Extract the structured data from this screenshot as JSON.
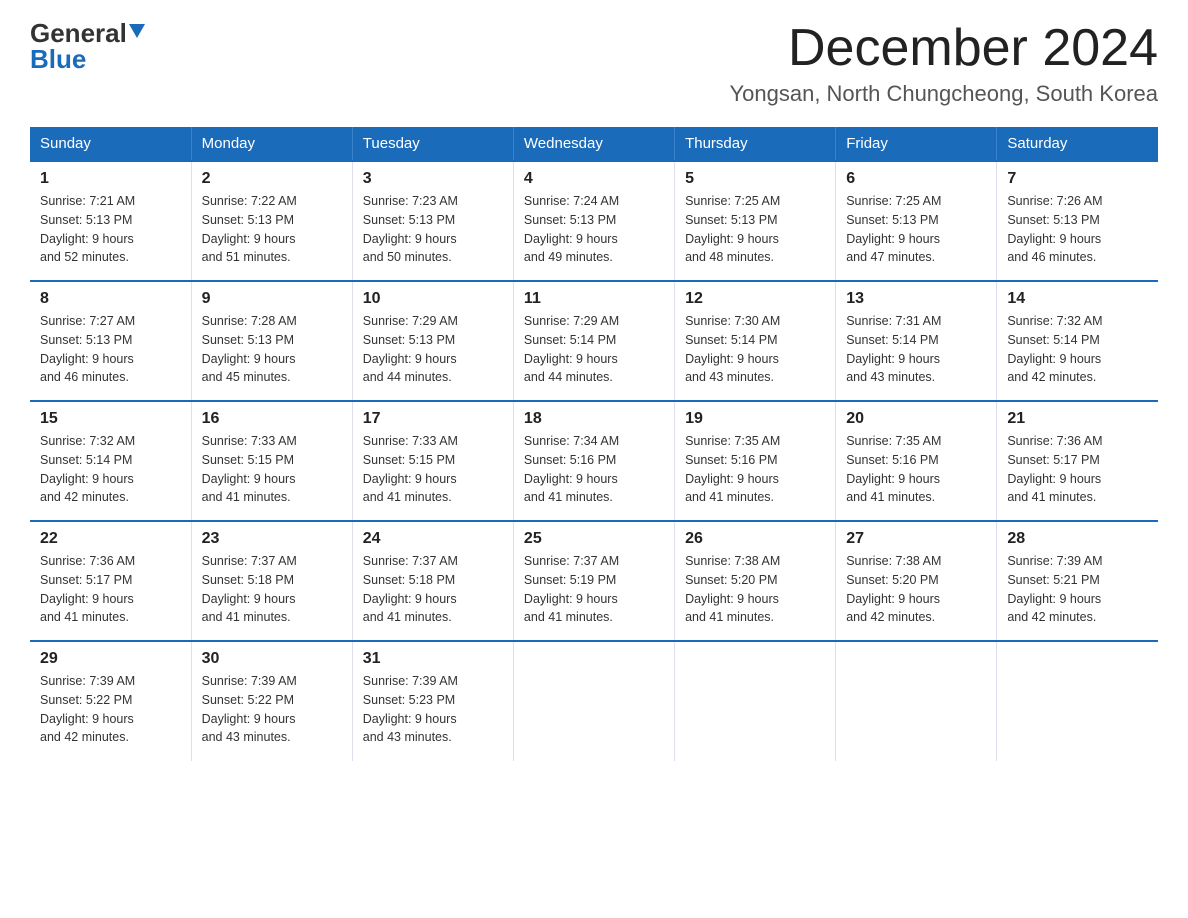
{
  "header": {
    "logo_general": "General",
    "logo_blue": "Blue",
    "month_title": "December 2024",
    "location": "Yongsan, North Chungcheong, South Korea"
  },
  "weekdays": [
    "Sunday",
    "Monday",
    "Tuesday",
    "Wednesday",
    "Thursday",
    "Friday",
    "Saturday"
  ],
  "weeks": [
    [
      {
        "day": "1",
        "sunrise": "7:21 AM",
        "sunset": "5:13 PM",
        "daylight": "9 hours and 52 minutes."
      },
      {
        "day": "2",
        "sunrise": "7:22 AM",
        "sunset": "5:13 PM",
        "daylight": "9 hours and 51 minutes."
      },
      {
        "day": "3",
        "sunrise": "7:23 AM",
        "sunset": "5:13 PM",
        "daylight": "9 hours and 50 minutes."
      },
      {
        "day": "4",
        "sunrise": "7:24 AM",
        "sunset": "5:13 PM",
        "daylight": "9 hours and 49 minutes."
      },
      {
        "day": "5",
        "sunrise": "7:25 AM",
        "sunset": "5:13 PM",
        "daylight": "9 hours and 48 minutes."
      },
      {
        "day": "6",
        "sunrise": "7:25 AM",
        "sunset": "5:13 PM",
        "daylight": "9 hours and 47 minutes."
      },
      {
        "day": "7",
        "sunrise": "7:26 AM",
        "sunset": "5:13 PM",
        "daylight": "9 hours and 46 minutes."
      }
    ],
    [
      {
        "day": "8",
        "sunrise": "7:27 AM",
        "sunset": "5:13 PM",
        "daylight": "9 hours and 46 minutes."
      },
      {
        "day": "9",
        "sunrise": "7:28 AM",
        "sunset": "5:13 PM",
        "daylight": "9 hours and 45 minutes."
      },
      {
        "day": "10",
        "sunrise": "7:29 AM",
        "sunset": "5:13 PM",
        "daylight": "9 hours and 44 minutes."
      },
      {
        "day": "11",
        "sunrise": "7:29 AM",
        "sunset": "5:14 PM",
        "daylight": "9 hours and 44 minutes."
      },
      {
        "day": "12",
        "sunrise": "7:30 AM",
        "sunset": "5:14 PM",
        "daylight": "9 hours and 43 minutes."
      },
      {
        "day": "13",
        "sunrise": "7:31 AM",
        "sunset": "5:14 PM",
        "daylight": "9 hours and 43 minutes."
      },
      {
        "day": "14",
        "sunrise": "7:32 AM",
        "sunset": "5:14 PM",
        "daylight": "9 hours and 42 minutes."
      }
    ],
    [
      {
        "day": "15",
        "sunrise": "7:32 AM",
        "sunset": "5:14 PM",
        "daylight": "9 hours and 42 minutes."
      },
      {
        "day": "16",
        "sunrise": "7:33 AM",
        "sunset": "5:15 PM",
        "daylight": "9 hours and 41 minutes."
      },
      {
        "day": "17",
        "sunrise": "7:33 AM",
        "sunset": "5:15 PM",
        "daylight": "9 hours and 41 minutes."
      },
      {
        "day": "18",
        "sunrise": "7:34 AM",
        "sunset": "5:16 PM",
        "daylight": "9 hours and 41 minutes."
      },
      {
        "day": "19",
        "sunrise": "7:35 AM",
        "sunset": "5:16 PM",
        "daylight": "9 hours and 41 minutes."
      },
      {
        "day": "20",
        "sunrise": "7:35 AM",
        "sunset": "5:16 PM",
        "daylight": "9 hours and 41 minutes."
      },
      {
        "day": "21",
        "sunrise": "7:36 AM",
        "sunset": "5:17 PM",
        "daylight": "9 hours and 41 minutes."
      }
    ],
    [
      {
        "day": "22",
        "sunrise": "7:36 AM",
        "sunset": "5:17 PM",
        "daylight": "9 hours and 41 minutes."
      },
      {
        "day": "23",
        "sunrise": "7:37 AM",
        "sunset": "5:18 PM",
        "daylight": "9 hours and 41 minutes."
      },
      {
        "day": "24",
        "sunrise": "7:37 AM",
        "sunset": "5:18 PM",
        "daylight": "9 hours and 41 minutes."
      },
      {
        "day": "25",
        "sunrise": "7:37 AM",
        "sunset": "5:19 PM",
        "daylight": "9 hours and 41 minutes."
      },
      {
        "day": "26",
        "sunrise": "7:38 AM",
        "sunset": "5:20 PM",
        "daylight": "9 hours and 41 minutes."
      },
      {
        "day": "27",
        "sunrise": "7:38 AM",
        "sunset": "5:20 PM",
        "daylight": "9 hours and 42 minutes."
      },
      {
        "day": "28",
        "sunrise": "7:39 AM",
        "sunset": "5:21 PM",
        "daylight": "9 hours and 42 minutes."
      }
    ],
    [
      {
        "day": "29",
        "sunrise": "7:39 AM",
        "sunset": "5:22 PM",
        "daylight": "9 hours and 42 minutes."
      },
      {
        "day": "30",
        "sunrise": "7:39 AM",
        "sunset": "5:22 PM",
        "daylight": "9 hours and 43 minutes."
      },
      {
        "day": "31",
        "sunrise": "7:39 AM",
        "sunset": "5:23 PM",
        "daylight": "9 hours and 43 minutes."
      },
      null,
      null,
      null,
      null
    ]
  ],
  "labels": {
    "sunrise": "Sunrise:",
    "sunset": "Sunset:",
    "daylight": "Daylight:"
  }
}
